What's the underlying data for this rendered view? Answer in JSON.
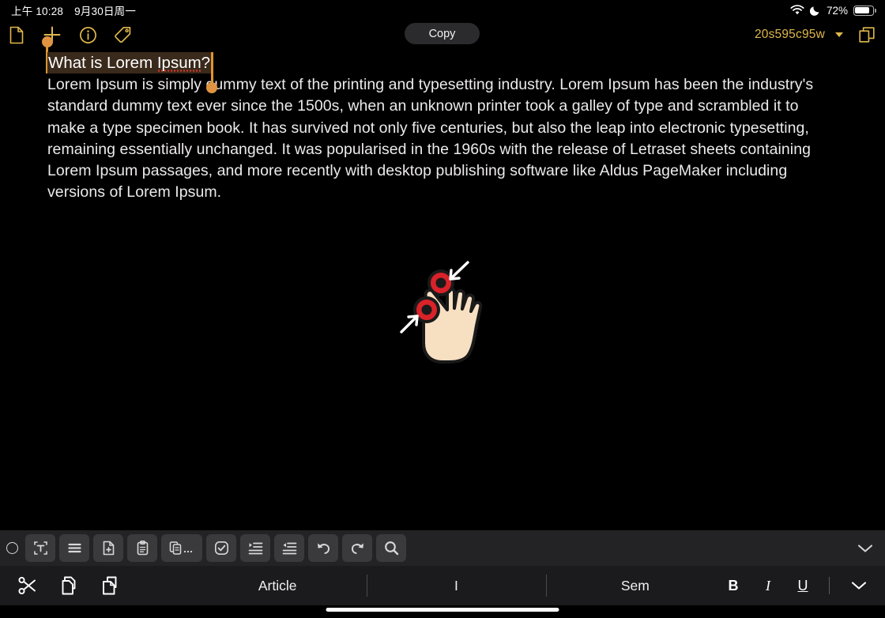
{
  "status_bar": {
    "time": "上午 10:28",
    "date": "9月30日周一",
    "wifi_icon": "wifi-icon",
    "dnd_icon": "moon-do-not-disturb-icon",
    "battery_percent": "72%",
    "battery_level": 72
  },
  "top_toolbar": {
    "icons": [
      {
        "name": "new-document-icon",
        "label": "New Document"
      },
      {
        "name": "add-plus-icon",
        "label": "Add"
      },
      {
        "name": "info-icon",
        "label": "Info"
      },
      {
        "name": "tag-icon",
        "label": "Tag"
      }
    ],
    "copy_label": "Copy",
    "document_name": "20s595c95w",
    "chevron_icon": "chevron-down-icon",
    "export_icon": "open-in-new-window-icon",
    "accent_color": "#e0b84c"
  },
  "document": {
    "title": "What is Lorem Ipsum?",
    "title_selected": true,
    "misspelled_word": "Ipsum",
    "selection_highlight_color": "#3a2a1c",
    "selection_handle_color": "#e0932f",
    "spellcheck_underline_color": "#e8392b",
    "body": "Lorem Ipsum is simply dummy text of the printing and typesetting industry. Lorem Ipsum has been the industry's standard dummy text ever since the 1500s, when an unknown printer took a galley of type and scrambled it to make a type specimen book. It has survived not only five centuries, but also the leap into electronic typesetting, remaining essentially unchanged. It was popularised in the 1960s with the release of Letraset sheets containing Lorem Ipsum passages, and more recently with desktop publishing software like Aldus PageMaker including versions of Lorem Ipsum."
  },
  "gesture_overlay": {
    "name": "pinch-in-gesture-icon",
    "touch_point_color": "#d92229",
    "hand_color": "#f7dfc2",
    "arrow_color": "#ffffff",
    "description": "two-finger pinch in"
  },
  "icon_toolbar": {
    "handle_icon": "circle-handle-icon",
    "items": [
      {
        "name": "select-text-frame-icon",
        "label": "Select Text Frame"
      },
      {
        "name": "menu-lines-icon",
        "label": "Menu"
      },
      {
        "name": "new-file-icon",
        "label": "New File"
      },
      {
        "name": "clipboard-icon",
        "label": "Clipboard"
      },
      {
        "name": "copy-stack-more-icon",
        "label": "Copy More"
      },
      {
        "name": "checkbox-task-icon",
        "label": "Task"
      },
      {
        "name": "indent-increase-icon",
        "label": "Increase Indent"
      },
      {
        "name": "indent-decrease-icon",
        "label": "Decrease Indent"
      },
      {
        "name": "undo-icon",
        "label": "Undo"
      },
      {
        "name": "redo-icon",
        "label": "Redo"
      },
      {
        "name": "search-icon",
        "label": "Search"
      }
    ],
    "collapse_icon": "chevron-down-icon",
    "background_color": "#232325",
    "button_color": "#3a3a3c"
  },
  "format_bar": {
    "left_icons": [
      {
        "name": "cut-scissors-icon",
        "label": "Cut"
      },
      {
        "name": "copy-icon",
        "label": "Copy"
      },
      {
        "name": "paste-icon",
        "label": "Paste"
      }
    ],
    "suggestions": [
      "Article",
      "I",
      "Sem"
    ],
    "style_buttons": [
      {
        "name": "bold-button",
        "label": "B"
      },
      {
        "name": "italic-button",
        "label": "I"
      },
      {
        "name": "underline-button",
        "label": "U"
      }
    ],
    "collapse_icon": "chevron-down-icon",
    "background_color": "#1b1b1d"
  },
  "home_indicator": {
    "name": "home-indicator"
  }
}
